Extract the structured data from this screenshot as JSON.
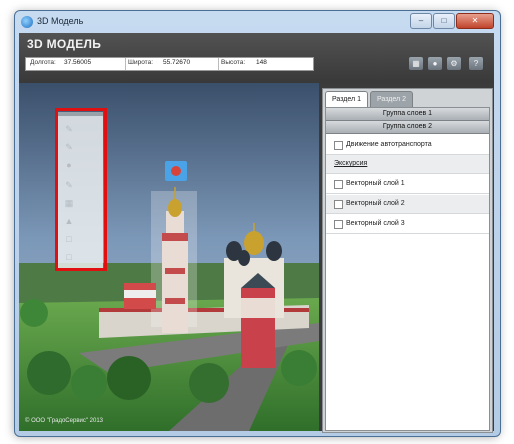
{
  "window": {
    "title": "3D Модель"
  },
  "header": {
    "app_title": "3D МОДЕЛЬ",
    "coords": [
      {
        "label": "Долгота:",
        "value": "37.56005"
      },
      {
        "label": "Широта:",
        "value": "55.72670"
      },
      {
        "label": "Высота:",
        "value": "148"
      }
    ],
    "toolbar_icons": [
      "screenshot-icon",
      "camera-icon",
      "settings-icon",
      "help-icon"
    ],
    "help_label": "?"
  },
  "panel": {
    "tabs": [
      {
        "label": "Раздел 1",
        "active": true
      },
      {
        "label": "Раздел 2",
        "active": false
      }
    ],
    "groups": [
      "Группа слоев 1",
      "Группа слоев 2"
    ],
    "layers": [
      {
        "label": "Движение автотранспорта",
        "checked": false
      },
      {
        "label": "Экскурсия",
        "type": "link"
      },
      {
        "label": "Векторный слой 1",
        "checked": false
      },
      {
        "label": "Векторный слой 2",
        "checked": false
      },
      {
        "label": "Векторный слой 3",
        "checked": false
      }
    ]
  },
  "viewport": {
    "copyright": "© ООО \"ГрадоСервис\" 2013"
  },
  "side_toolbar": {
    "tools": [
      "tool-1-icon",
      "tool-2-icon",
      "tool-3-icon",
      "tool-4-icon",
      "tool-5-icon",
      "tool-6-icon",
      "tool-7-icon",
      "tool-8-icon"
    ]
  },
  "colors": {
    "header_bg": "#444444",
    "panel_bg": "#ffffff",
    "highlight": "#e01010",
    "sky": "#5f7da0",
    "grass": "#4e9a3c"
  }
}
